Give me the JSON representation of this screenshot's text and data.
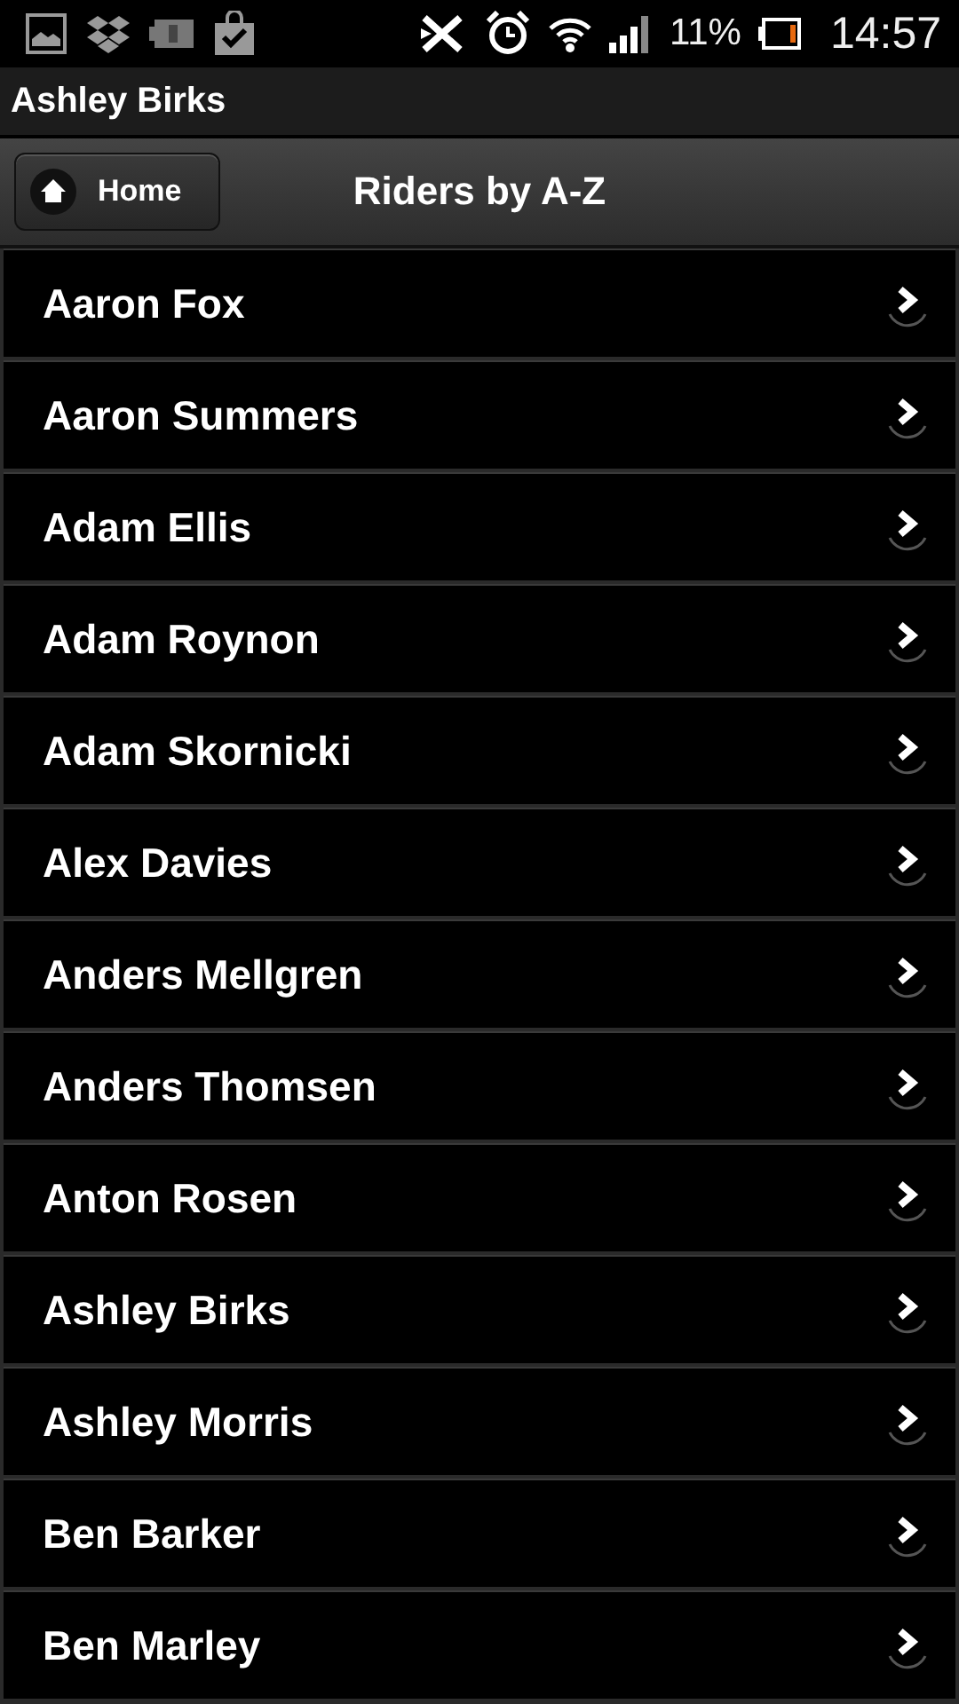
{
  "status_bar": {
    "battery": "11%",
    "time": "14:57"
  },
  "app_bar": {
    "title": "Ashley Birks"
  },
  "header": {
    "back_button": "Home",
    "title": "Riders by A-Z"
  },
  "riders": [
    {
      "name": "Aaron Fox"
    },
    {
      "name": "Aaron Summers"
    },
    {
      "name": "Adam Ellis"
    },
    {
      "name": "Adam Roynon"
    },
    {
      "name": "Adam Skornicki"
    },
    {
      "name": "Alex Davies"
    },
    {
      "name": "Anders Mellgren"
    },
    {
      "name": "Anders Thomsen"
    },
    {
      "name": "Anton Rosen"
    },
    {
      "name": "Ashley Birks"
    },
    {
      "name": "Ashley Morris"
    },
    {
      "name": "Ben Barker"
    },
    {
      "name": "Ben Marley"
    }
  ]
}
